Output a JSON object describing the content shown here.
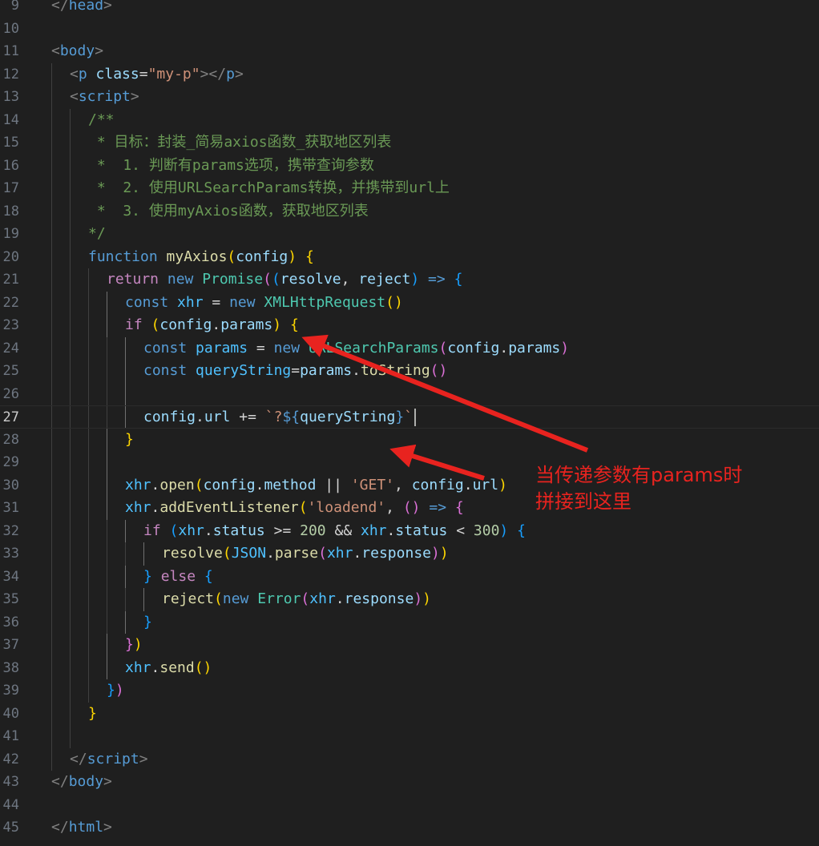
{
  "editor": {
    "current_line": 27,
    "lines": [
      {
        "n": "9",
        "indent": 0,
        "code": [
          [
            "tag",
            "</"
          ],
          [
            "tagname",
            "head"
          ],
          [
            "tag",
            ">"
          ]
        ]
      },
      {
        "n": "10",
        "indent": 0,
        "code": []
      },
      {
        "n": "11",
        "indent": 0,
        "code": [
          [
            "tag",
            "<"
          ],
          [
            "tagname",
            "body"
          ],
          [
            "tag",
            ">"
          ]
        ]
      },
      {
        "n": "12",
        "indent": 1,
        "code": [
          [
            "tag",
            "<"
          ],
          [
            "tagname",
            "p"
          ],
          [
            "op",
            " "
          ],
          [
            "attr",
            "class"
          ],
          [
            "op",
            "="
          ],
          [
            "str",
            "\"my-p\""
          ],
          [
            "tag",
            "></"
          ],
          [
            "tagname",
            "p"
          ],
          [
            "tag",
            ">"
          ]
        ]
      },
      {
        "n": "13",
        "indent": 1,
        "code": [
          [
            "tag",
            "<"
          ],
          [
            "tagname",
            "script"
          ],
          [
            "tag",
            ">"
          ]
        ]
      },
      {
        "n": "14",
        "indent": 2,
        "code": [
          [
            "cm",
            "/**"
          ]
        ]
      },
      {
        "n": "15",
        "indent": 2,
        "code": [
          [
            "cm",
            " * 目标：封装_简易axios函数_获取地区列表"
          ]
        ]
      },
      {
        "n": "16",
        "indent": 2,
        "code": [
          [
            "cm",
            " *  1. 判断有params选项，携带查询参数"
          ]
        ]
      },
      {
        "n": "17",
        "indent": 2,
        "code": [
          [
            "cm",
            " *  2. 使用URLSearchParams转换，并携带到url上"
          ]
        ]
      },
      {
        "n": "18",
        "indent": 2,
        "code": [
          [
            "cm",
            " *  3. 使用myAxios函数，获取地区列表"
          ]
        ]
      },
      {
        "n": "19",
        "indent": 2,
        "code": [
          [
            "cm",
            "*/"
          ]
        ]
      },
      {
        "n": "20",
        "indent": 2,
        "code": [
          [
            "kw",
            "function"
          ],
          [
            "op",
            " "
          ],
          [
            "fn",
            "myAxios"
          ],
          [
            "b1",
            "("
          ],
          [
            "var",
            "config"
          ],
          [
            "b1",
            ")"
          ],
          [
            "op",
            " "
          ],
          [
            "b1",
            "{"
          ]
        ]
      },
      {
        "n": "21",
        "indent": 3,
        "code": [
          [
            "ctl",
            "return"
          ],
          [
            "op",
            " "
          ],
          [
            "kw",
            "new"
          ],
          [
            "op",
            " "
          ],
          [
            "cls",
            "Promise"
          ],
          [
            "b2",
            "("
          ],
          [
            "b3",
            "("
          ],
          [
            "var",
            "resolve"
          ],
          [
            "op",
            ", "
          ],
          [
            "var",
            "reject"
          ],
          [
            "b3",
            ")"
          ],
          [
            "op",
            " "
          ],
          [
            "kw",
            "=>"
          ],
          [
            "op",
            " "
          ],
          [
            "b3",
            "{"
          ]
        ]
      },
      {
        "n": "22",
        "indent": 4,
        "code": [
          [
            "kw",
            "const"
          ],
          [
            "op",
            " "
          ],
          [
            "cst",
            "xhr"
          ],
          [
            "op",
            " = "
          ],
          [
            "kw",
            "new"
          ],
          [
            "op",
            " "
          ],
          [
            "cls",
            "XMLHttpRequest"
          ],
          [
            "b1",
            "()"
          ]
        ]
      },
      {
        "n": "23",
        "indent": 4,
        "code": [
          [
            "ctl",
            "if"
          ],
          [
            "op",
            " "
          ],
          [
            "b1",
            "("
          ],
          [
            "var",
            "config"
          ],
          [
            "op",
            "."
          ],
          [
            "var",
            "params"
          ],
          [
            "b1",
            ")"
          ],
          [
            "op",
            " "
          ],
          [
            "b1",
            "{"
          ]
        ]
      },
      {
        "n": "24",
        "indent": 5,
        "code": [
          [
            "kw",
            "const"
          ],
          [
            "op",
            " "
          ],
          [
            "cst",
            "params"
          ],
          [
            "op",
            " = "
          ],
          [
            "kw",
            "new"
          ],
          [
            "op",
            " "
          ],
          [
            "cls",
            "URLSearchParams"
          ],
          [
            "b2",
            "("
          ],
          [
            "var",
            "config"
          ],
          [
            "op",
            "."
          ],
          [
            "var",
            "params"
          ],
          [
            "b2",
            ")"
          ]
        ]
      },
      {
        "n": "25",
        "indent": 5,
        "code": [
          [
            "kw",
            "const"
          ],
          [
            "op",
            " "
          ],
          [
            "cst",
            "queryString"
          ],
          [
            "op",
            "="
          ],
          [
            "var",
            "params"
          ],
          [
            "op",
            "."
          ],
          [
            "fn",
            "toString"
          ],
          [
            "b2",
            "()"
          ]
        ]
      },
      {
        "n": "26",
        "indent": 5,
        "code": []
      },
      {
        "n": "27",
        "indent": 5,
        "code": [
          [
            "var",
            "config"
          ],
          [
            "op",
            "."
          ],
          [
            "var",
            "url"
          ],
          [
            "op",
            " += "
          ],
          [
            "tpl",
            "`?"
          ],
          [
            "tplx",
            "${"
          ],
          [
            "var",
            "queryString"
          ],
          [
            "tplx",
            "}"
          ],
          [
            "tpl",
            "`"
          ]
        ]
      },
      {
        "n": "28",
        "indent": 4,
        "code": [
          [
            "b1",
            "}"
          ]
        ]
      },
      {
        "n": "29",
        "indent": 4,
        "code": []
      },
      {
        "n": "30",
        "indent": 4,
        "code": [
          [
            "cst",
            "xhr"
          ],
          [
            "op",
            "."
          ],
          [
            "fn",
            "open"
          ],
          [
            "b1",
            "("
          ],
          [
            "var",
            "config"
          ],
          [
            "op",
            "."
          ],
          [
            "var",
            "method"
          ],
          [
            "op",
            " || "
          ],
          [
            "str",
            "'GET'"
          ],
          [
            "op",
            ", "
          ],
          [
            "var",
            "config"
          ],
          [
            "op",
            "."
          ],
          [
            "var",
            "url"
          ],
          [
            "b1",
            ")"
          ]
        ]
      },
      {
        "n": "31",
        "indent": 4,
        "code": [
          [
            "cst",
            "xhr"
          ],
          [
            "op",
            "."
          ],
          [
            "fn",
            "addEventListener"
          ],
          [
            "b1",
            "("
          ],
          [
            "str",
            "'loadend'"
          ],
          [
            "op",
            ", "
          ],
          [
            "b2",
            "()"
          ],
          [
            "op",
            " "
          ],
          [
            "kw",
            "=>"
          ],
          [
            "op",
            " "
          ],
          [
            "b2",
            "{"
          ]
        ]
      },
      {
        "n": "32",
        "indent": 5,
        "code": [
          [
            "ctl",
            "if"
          ],
          [
            "op",
            " "
          ],
          [
            "b3",
            "("
          ],
          [
            "cst",
            "xhr"
          ],
          [
            "op",
            "."
          ],
          [
            "var",
            "status"
          ],
          [
            "op",
            " >= "
          ],
          [
            "num",
            "200"
          ],
          [
            "op",
            " && "
          ],
          [
            "cst",
            "xhr"
          ],
          [
            "op",
            "."
          ],
          [
            "var",
            "status"
          ],
          [
            "op",
            " < "
          ],
          [
            "num",
            "300"
          ],
          [
            "b3",
            ")"
          ],
          [
            "op",
            " "
          ],
          [
            "b3",
            "{"
          ]
        ]
      },
      {
        "n": "33",
        "indent": 6,
        "code": [
          [
            "fn",
            "resolve"
          ],
          [
            "b1",
            "("
          ],
          [
            "cst",
            "JSON"
          ],
          [
            "op",
            "."
          ],
          [
            "fn",
            "parse"
          ],
          [
            "b2",
            "("
          ],
          [
            "cst",
            "xhr"
          ],
          [
            "op",
            "."
          ],
          [
            "var",
            "response"
          ],
          [
            "b2",
            ")"
          ],
          [
            "b1",
            ")"
          ]
        ]
      },
      {
        "n": "34",
        "indent": 5,
        "code": [
          [
            "b3",
            "}"
          ],
          [
            "op",
            " "
          ],
          [
            "ctl",
            "else"
          ],
          [
            "op",
            " "
          ],
          [
            "b3",
            "{"
          ]
        ]
      },
      {
        "n": "35",
        "indent": 6,
        "code": [
          [
            "fn",
            "reject"
          ],
          [
            "b1",
            "("
          ],
          [
            "kw",
            "new"
          ],
          [
            "op",
            " "
          ],
          [
            "cls",
            "Error"
          ],
          [
            "b2",
            "("
          ],
          [
            "cst",
            "xhr"
          ],
          [
            "op",
            "."
          ],
          [
            "var",
            "response"
          ],
          [
            "b2",
            ")"
          ],
          [
            "b1",
            ")"
          ]
        ]
      },
      {
        "n": "36",
        "indent": 5,
        "code": [
          [
            "b3",
            "}"
          ]
        ]
      },
      {
        "n": "37",
        "indent": 4,
        "code": [
          [
            "b2",
            "}"
          ],
          [
            "b1",
            ")"
          ]
        ]
      },
      {
        "n": "38",
        "indent": 4,
        "code": [
          [
            "cst",
            "xhr"
          ],
          [
            "op",
            "."
          ],
          [
            "fn",
            "send"
          ],
          [
            "b1",
            "()"
          ]
        ]
      },
      {
        "n": "39",
        "indent": 3,
        "code": [
          [
            "b3",
            "}"
          ],
          [
            "b2",
            ")"
          ]
        ]
      },
      {
        "n": "40",
        "indent": 2,
        "code": [
          [
            "b1",
            "}"
          ]
        ]
      },
      {
        "n": "41",
        "indent": 2,
        "code": []
      },
      {
        "n": "42",
        "indent": 1,
        "code": [
          [
            "tag",
            "</"
          ],
          [
            "tagname",
            "script"
          ],
          [
            "tag",
            ">"
          ]
        ]
      },
      {
        "n": "43",
        "indent": 0,
        "code": [
          [
            "tag",
            "</"
          ],
          [
            "tagname",
            "body"
          ],
          [
            "tag",
            ">"
          ]
        ]
      },
      {
        "n": "44",
        "indent": 0,
        "code": []
      },
      {
        "n": "45",
        "indent": 0,
        "code": [
          [
            "tag",
            "</"
          ],
          [
            "tagname",
            "html"
          ],
          [
            "tag",
            ">"
          ]
        ]
      }
    ]
  },
  "annotation": {
    "line1": "当传递参数有params时",
    "line2": "拼接到这里",
    "color": "#e8231f"
  }
}
